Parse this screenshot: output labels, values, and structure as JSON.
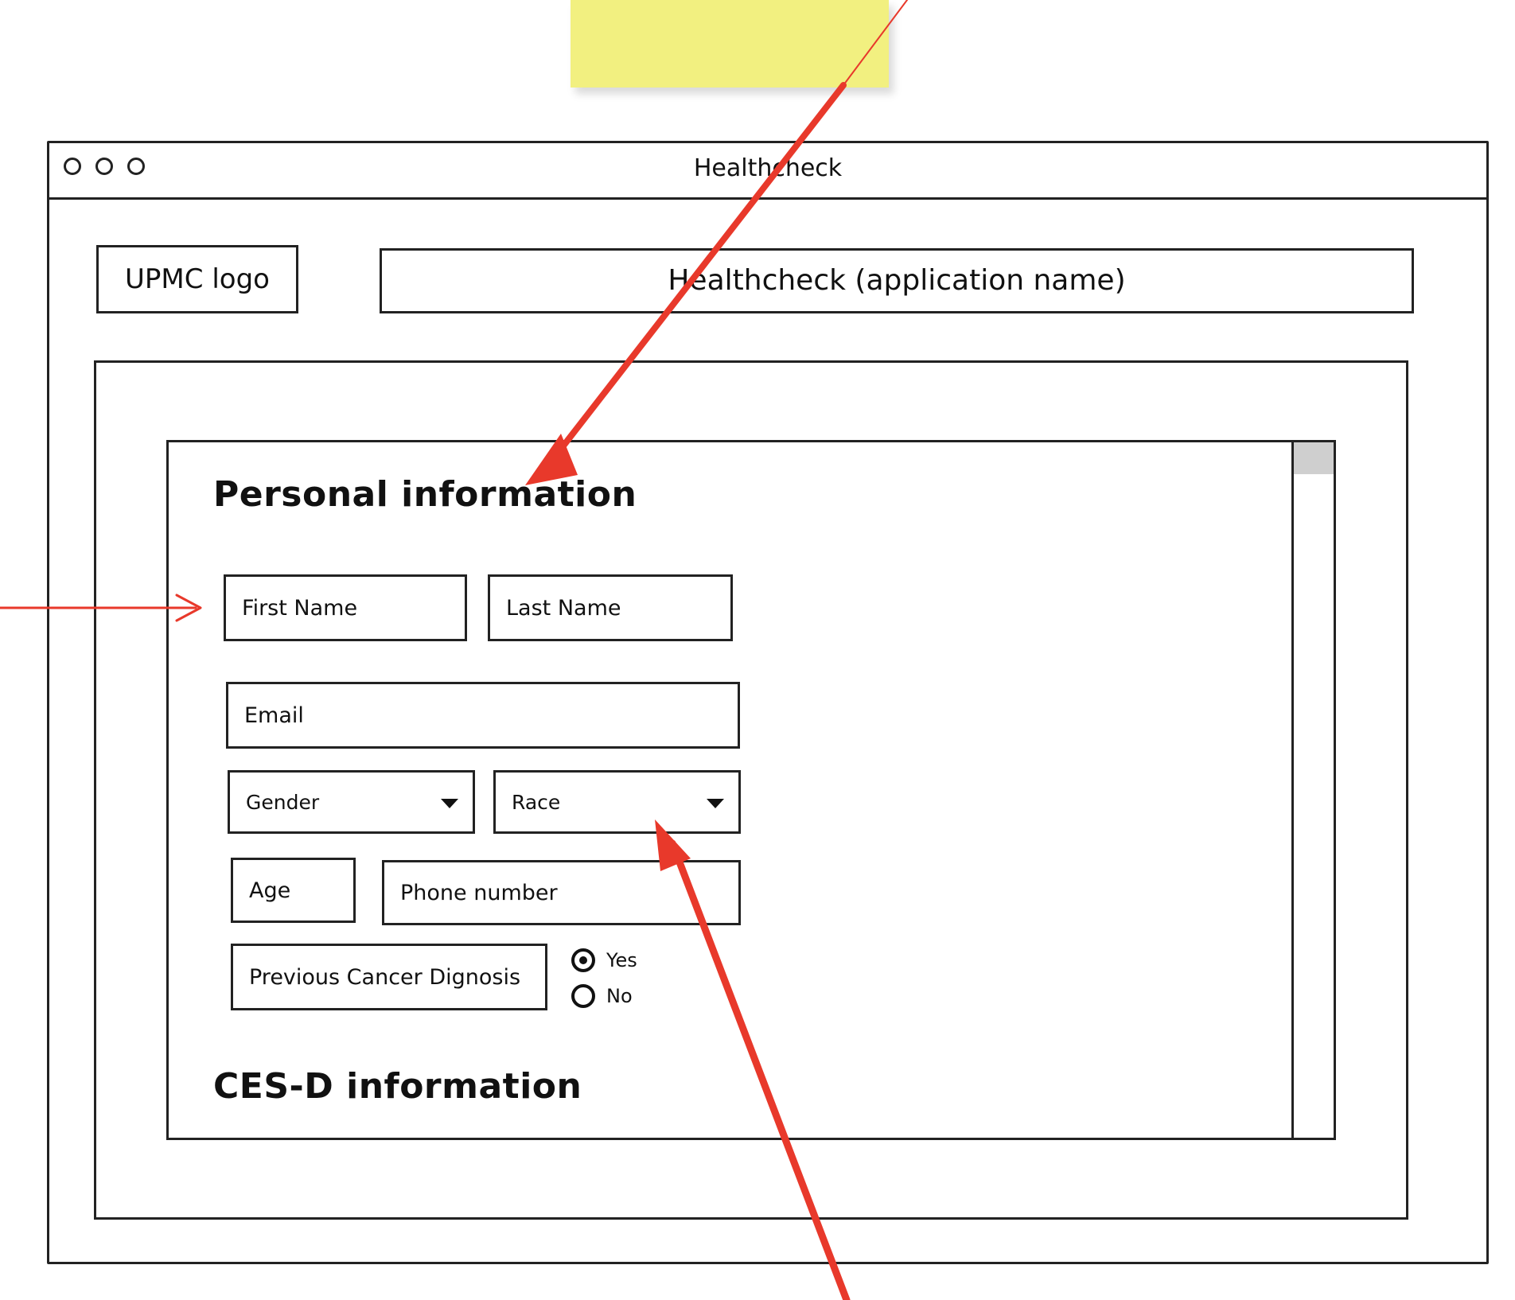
{
  "window": {
    "title": "Healthcheck"
  },
  "header": {
    "logo_label": "UPMC logo",
    "app_name": "Healthcheck (application name)"
  },
  "form": {
    "personal_section_title": "Personal information",
    "first_name_placeholder": "First Name",
    "last_name_placeholder": "Last Name",
    "email_placeholder": "Email",
    "gender_label": "Gender",
    "race_label": "Race",
    "age_placeholder": "Age",
    "phone_placeholder": "Phone number",
    "previous_cancer_label": "Previous Cancer Dignosis",
    "radio_yes": "Yes",
    "radio_no": "No",
    "selected_radio": "Yes",
    "cesd_section_title": "CES-D information"
  },
  "colors": {
    "sticky_note": "#f2f080",
    "annotation_arrow": "#e8392b",
    "sketch_stroke": "#222222"
  }
}
